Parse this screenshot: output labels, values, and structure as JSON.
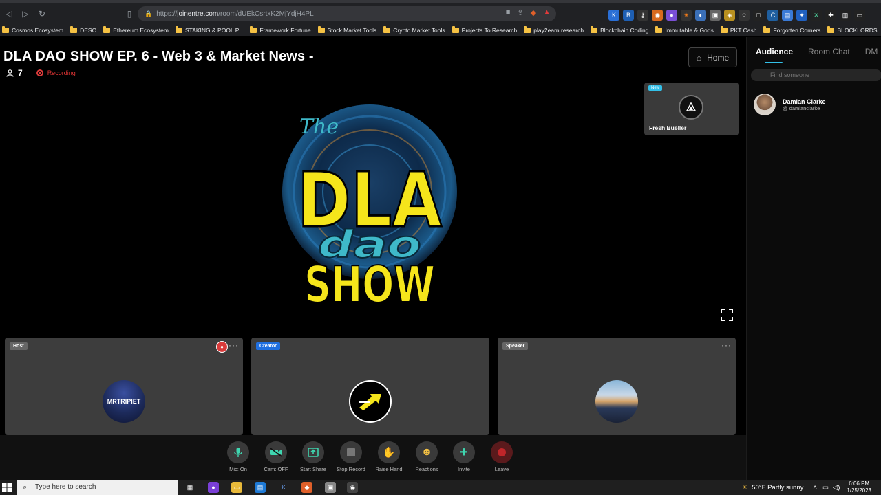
{
  "browser": {
    "url": "https://joinentre.com/room/dUEkCsrtxK2MjYdjH4PL",
    "url_host": "joinentre.com",
    "url_prefix": "https://",
    "url_path": "/room/dUEkCsrtxK2MjYdjH4PL",
    "bookmarks": [
      "Cosmos Ecosystem",
      "DESO",
      "Ethereum Ecosystem",
      "STAKING & POOL P...",
      "Framework Fortune",
      "Stock Market Tools",
      "Crypto Market Tools",
      "Projects To Research",
      "play2earn research",
      "Blockchain Coding",
      "Immutable & Gods",
      "PKT Cash",
      "Forgotten Corners",
      "BLOCKLORDS"
    ]
  },
  "room": {
    "title": "DLA DAO SHOW EP. 6 - Web 3 & Market News -",
    "participant_count": "7",
    "recording_label": "Recording",
    "home_label": "Home"
  },
  "logo": {
    "the": "The",
    "dla": "DLA",
    "dao": "dao",
    "show": "SHOW"
  },
  "tiles": {
    "fresh": {
      "badge": "New",
      "name": "Fresh Bueller"
    },
    "host": {
      "role": "Host",
      "avatar_text": "MRTRIPIET"
    },
    "creator": {
      "role": "Creator"
    },
    "speaker": {
      "role": "Speaker"
    }
  },
  "side": {
    "tabs": [
      "Audience",
      "Room Chat",
      "DM"
    ],
    "find_placeholder": "Find someone",
    "member": {
      "name": "Damian Clarke",
      "handle": "@ damianclarke"
    }
  },
  "controls": [
    {
      "label": "Mic: On",
      "icon": "mic-icon"
    },
    {
      "label": "Cam: OFF",
      "icon": "camera-off-icon"
    },
    {
      "label": "Start Share",
      "icon": "share-screen-icon"
    },
    {
      "label": "Stop Record",
      "icon": "stop-icon"
    },
    {
      "label": "Raise Hand",
      "icon": "hand-icon"
    },
    {
      "label": "Reactions",
      "icon": "smile-icon"
    },
    {
      "label": "Invite",
      "icon": "plus-icon"
    },
    {
      "label": "Leave",
      "icon": "leave-icon"
    }
  ],
  "taskbar": {
    "search_placeholder": "Type here to search",
    "weather": "50°F  Partly sunny",
    "time": "6:06 PM",
    "date": "1/25/2023"
  },
  "colors": {
    "accent": "#33c0e8",
    "record": "#e23535",
    "logo_yellow": "#f5e51b",
    "logo_teal": "#3fb9c9"
  }
}
